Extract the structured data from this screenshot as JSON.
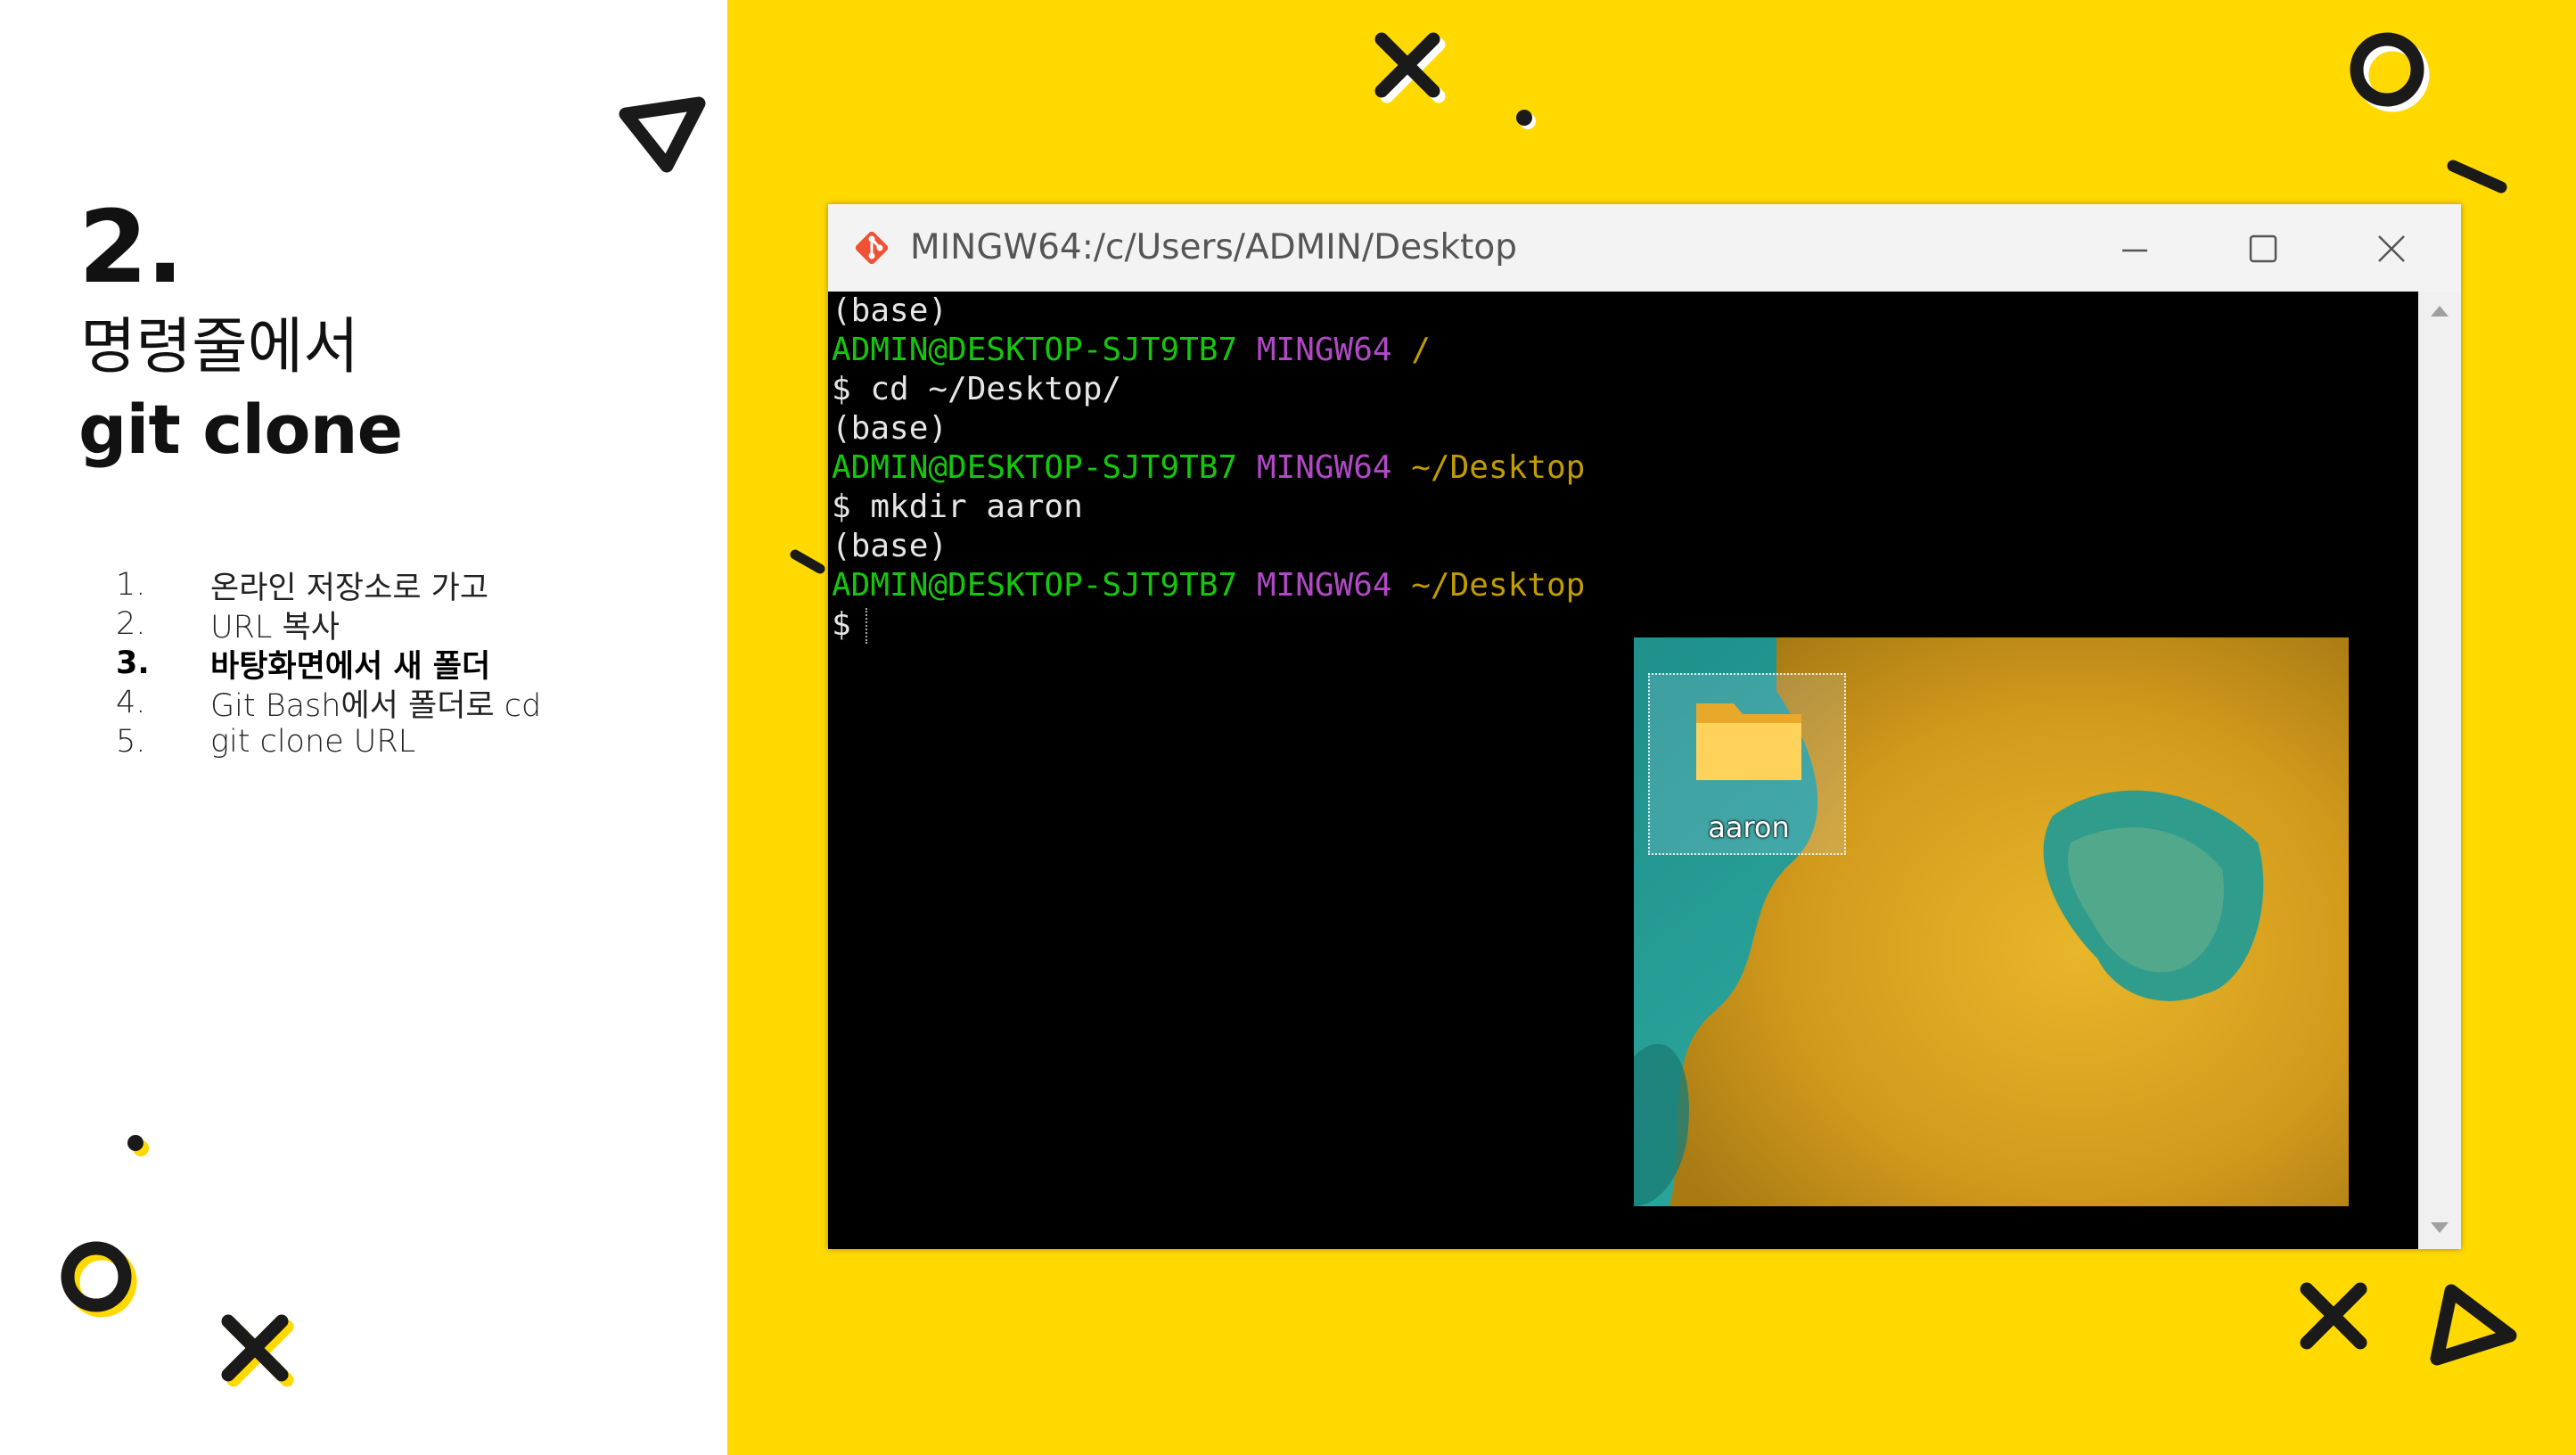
{
  "slide": {
    "step_number": "2.",
    "subtitle": "명령줄에서",
    "title": "git clone",
    "steps": [
      {
        "num": "1.",
        "text": "온라인 저장소로 가고"
      },
      {
        "num": "2.",
        "text": "URL 복사"
      },
      {
        "num": "3.",
        "text": "바탕화면에서 새 폴더"
      },
      {
        "num": "4.",
        "text": "Git Bash에서 폴더로 cd"
      },
      {
        "num": "5.",
        "text": "git clone URL"
      }
    ],
    "active_step": 3
  },
  "window": {
    "title": "MINGW64:/c/Users/ADMIN/Desktop",
    "minimize_icon": "minimize-icon",
    "maximize_icon": "maximize-icon",
    "close_icon": "close-icon"
  },
  "terminal": {
    "lines": [
      {
        "base": "(base)"
      },
      {
        "user": "ADMIN@DESKTOP-SJT9TB7",
        "shell": "MINGW64",
        "path": "/"
      },
      {
        "cmd": "$ cd ~/Desktop/"
      },
      {
        "base": "(base)"
      },
      {
        "user": "ADMIN@DESKTOP-SJT9TB7",
        "shell": "MINGW64",
        "path": "~/Desktop"
      },
      {
        "cmd": "$ mkdir aaron"
      },
      {
        "base": "(base)"
      },
      {
        "user": "ADMIN@DESKTOP-SJT9TB7",
        "shell": "MINGW64",
        "path": "~/Desktop"
      },
      {
        "cmd": "$"
      }
    ]
  },
  "desktop": {
    "folder_label": "aaron",
    "folder_icon": "folder-icon"
  },
  "colors": {
    "background_yellow": "#ffd900",
    "terminal_green": "#16c60c",
    "terminal_magenta": "#b148c6",
    "terminal_yellow": "#c19c00"
  }
}
